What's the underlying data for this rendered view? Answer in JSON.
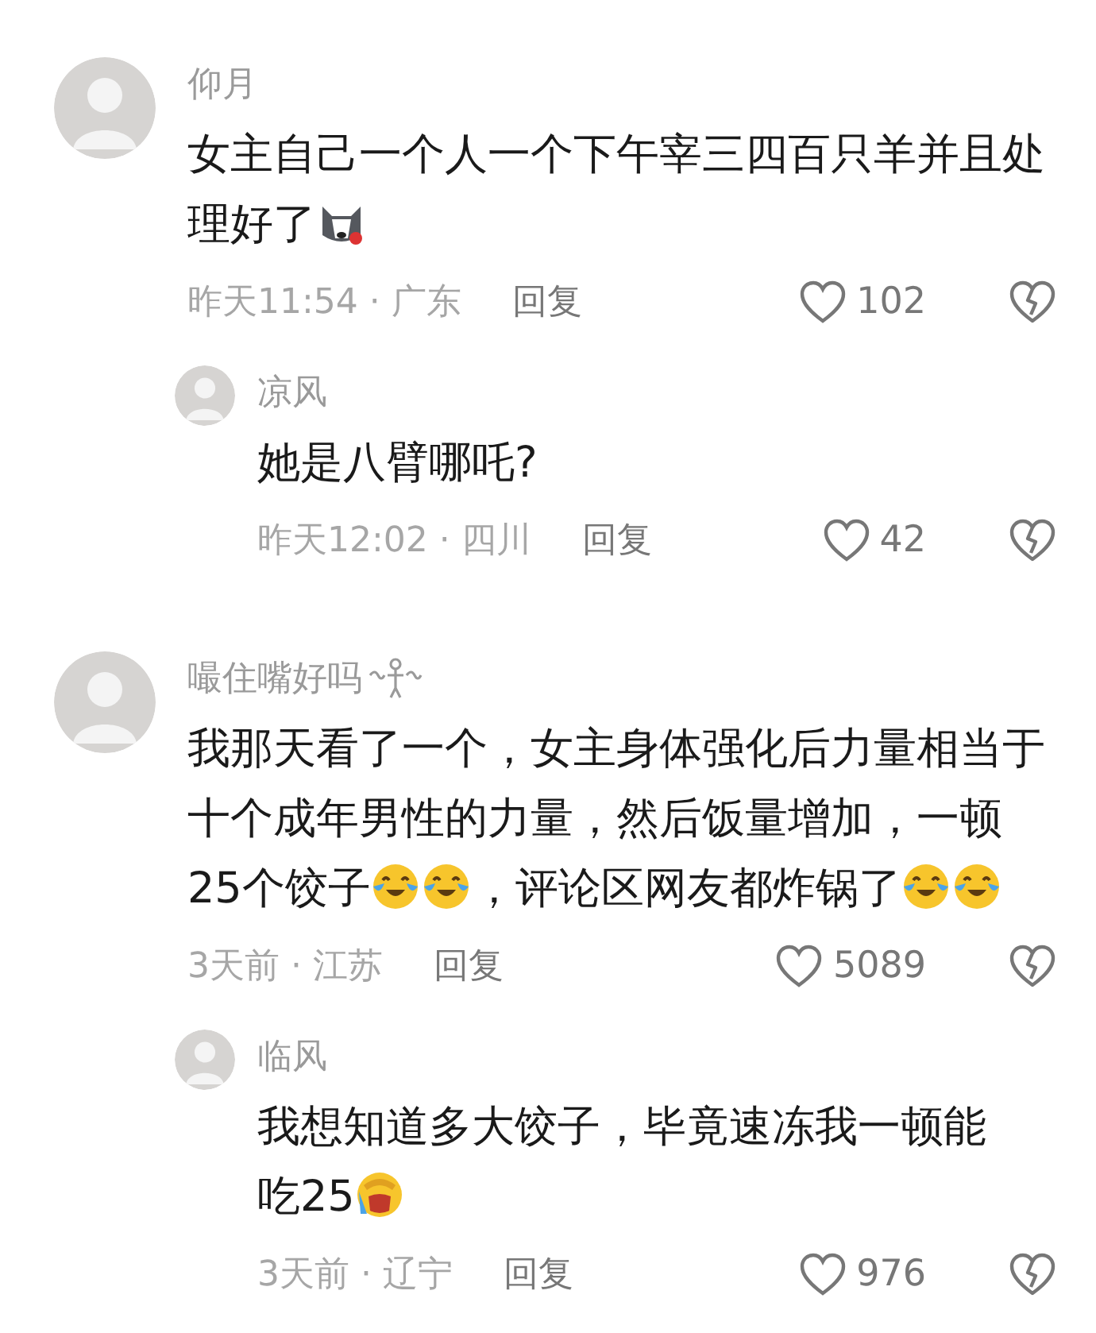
{
  "comments": [
    {
      "name": "仰月",
      "parts": [
        {
          "kind": "text",
          "text": "女主自己一个人一个下午宰三四百只羊并且处理好了"
        },
        {
          "kind": "dog"
        }
      ],
      "time": "昨天11:54 · 广东",
      "reply": "回复",
      "likes": "102",
      "replies": [
        {
          "name": "凉风",
          "parts": [
            {
              "kind": "text",
              "text": "她是八臂哪吒?"
            }
          ],
          "time": "昨天12:02 · 四川",
          "reply": "回复",
          "likes": "42"
        }
      ]
    },
    {
      "name": "嘬住嘴好吗",
      "name_flourish": true,
      "parts": [
        {
          "kind": "text",
          "text": "我那天看了一个，女主身体强化后力量相当于十个成年男性的力量，然后饭量增加，一顿25个饺子"
        },
        {
          "kind": "cry"
        },
        {
          "kind": "cry"
        },
        {
          "kind": "text",
          "text": "，评论区网友都炸锅了"
        },
        {
          "kind": "cry"
        },
        {
          "kind": "cry"
        }
      ],
      "time": "3天前 · 江苏",
      "reply": "回复",
      "likes": "5089",
      "replies": [
        {
          "name": "临风",
          "parts": [
            {
              "kind": "text",
              "text": "我想知道多大饺子，毕竟速冻我一顿能吃25"
            },
            {
              "kind": "facepalm"
            }
          ],
          "time": "3天前 · 辽宁",
          "reply": "回复",
          "likes": "976"
        }
      ]
    }
  ]
}
